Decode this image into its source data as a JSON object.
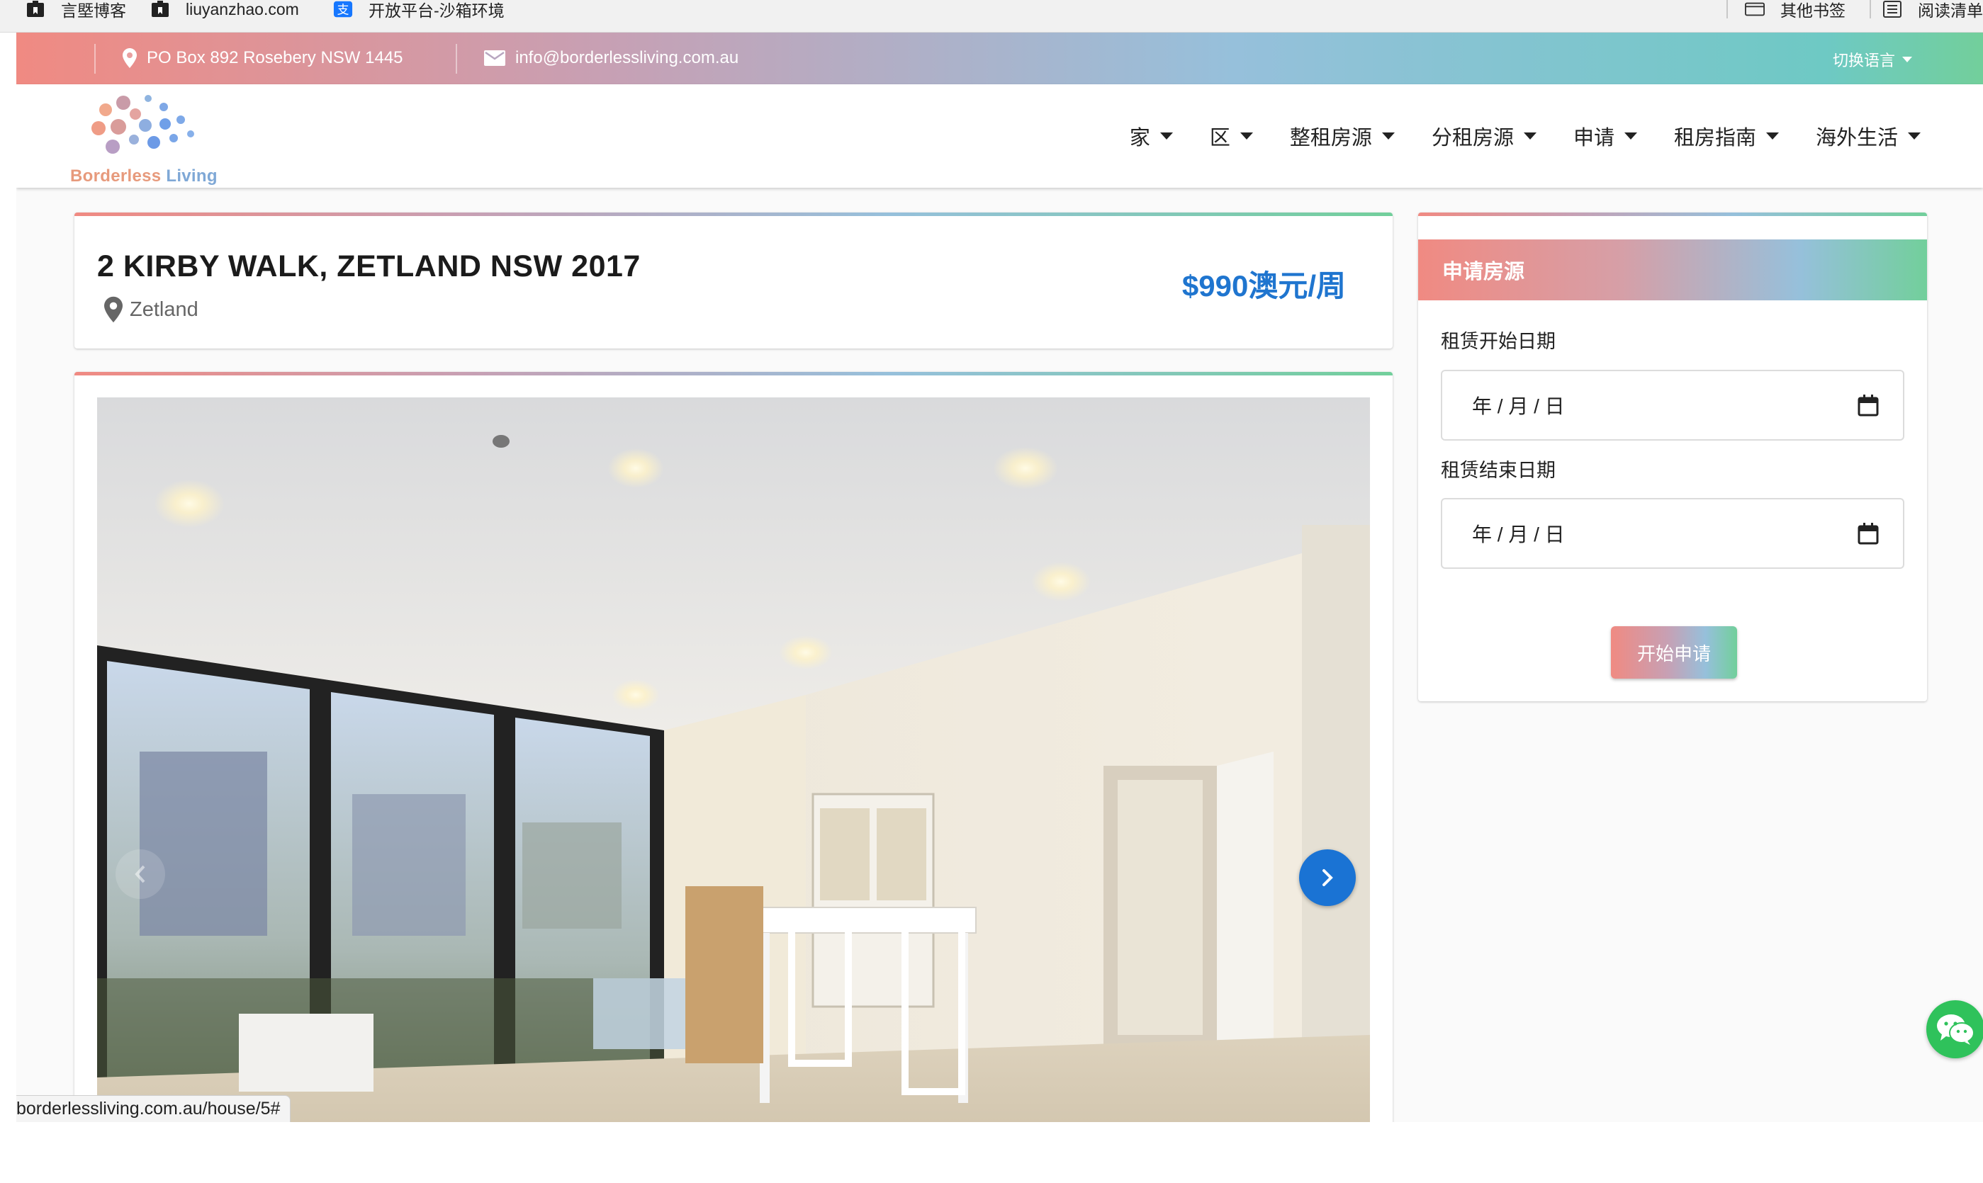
{
  "bookmarks_bar": {
    "items": [
      {
        "label": "言塈博客",
        "icon": "bookmark-folder-icon"
      },
      {
        "label": "liuyanzhao.com",
        "icon": "bookmark-folder-icon"
      },
      {
        "label": "开放平台-沙箱环境",
        "icon": "alipay-icon"
      }
    ],
    "right_items": [
      {
        "label": "其他书签",
        "icon": "folder-icon"
      },
      {
        "label": "阅读清单",
        "icon": "reading-list-icon"
      }
    ]
  },
  "topbar": {
    "address": "PO Box 892 Rosebery NSW 1445",
    "email": "info@borderlessliving.com.au",
    "language_label": "切换语言"
  },
  "logo": {
    "text_part1": "Borderless",
    "text_part2": "Living"
  },
  "nav": {
    "items": [
      {
        "label": "家"
      },
      {
        "label": "区"
      },
      {
        "label": "整租房源"
      },
      {
        "label": "分租房源"
      },
      {
        "label": "申请"
      },
      {
        "label": "租房指南"
      },
      {
        "label": "海外生活"
      }
    ]
  },
  "listing": {
    "title": "2 KIRBY WALK, ZETLAND NSW 2017",
    "location": "Zetland",
    "price": "$990澳元/周"
  },
  "apply": {
    "heading": "申请房源",
    "start_label": "租赁开始日期",
    "start_placeholder": "年 / 月 / 日",
    "end_label": "租赁结束日期",
    "end_placeholder": "年 / 月 / 日",
    "button": "开始申请"
  },
  "status_url": "borderlessliving.com.au/house/5#",
  "colors": {
    "accent_blue": "#1a73d4",
    "price_blue": "#1f75cf",
    "gradient_start": "#f08a82",
    "gradient_end": "#72cf9b",
    "wechat_green": "#2fc25b"
  }
}
